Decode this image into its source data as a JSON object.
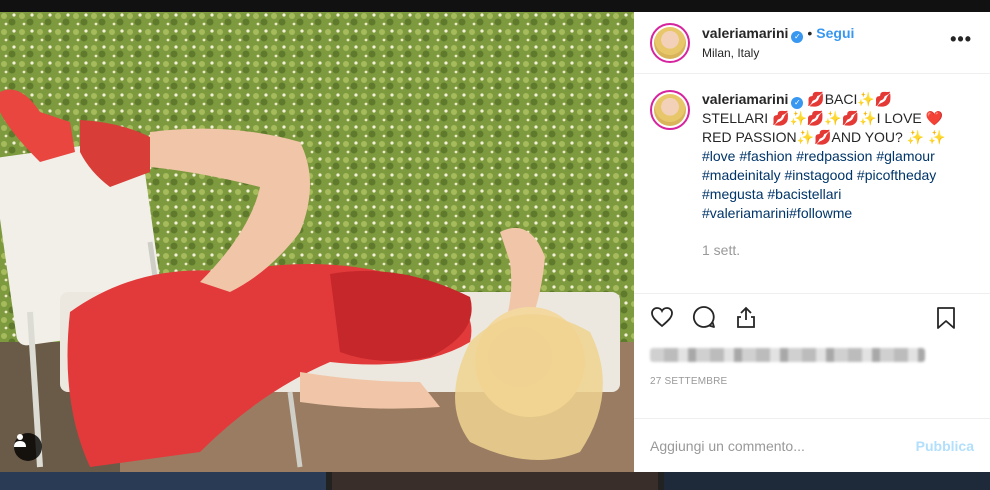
{
  "post": {
    "username": "valeriamarini",
    "verified_icon": "verified-badge-icon",
    "dot": "•",
    "follow_label": "Segui",
    "location": "Milan, Italy",
    "more_label": "•••"
  },
  "caption": {
    "username": "valeriamarini",
    "text": "💋BACI✨💋STELLARI 💋✨💋✨💋✨I LOVE ❤️RED PASSION✨💋AND YOU? ✨ ✨",
    "hashtags": [
      "#love",
      "#fashion",
      "#redpassion",
      "#glamour",
      "#madeinitaly",
      "#instagood",
      "#picoftheday",
      "#megusta",
      "#bacistellari",
      "#valeriamarini#followme"
    ],
    "time_ago": "1 sett."
  },
  "actions": {
    "like_icon": "heart-icon",
    "comment_icon": "comment-icon",
    "share_icon": "share-icon",
    "save_icon": "bookmark-icon"
  },
  "date_label": "27 SETTEMBRE",
  "comment_box": {
    "placeholder": "Aggiungi un commento...",
    "publish_label": "Pubblica"
  },
  "colors": {
    "accent": "#3897f0",
    "publish_disabled": "#b2dffc",
    "hashtag": "#003569",
    "dress": "#e23a3a"
  }
}
